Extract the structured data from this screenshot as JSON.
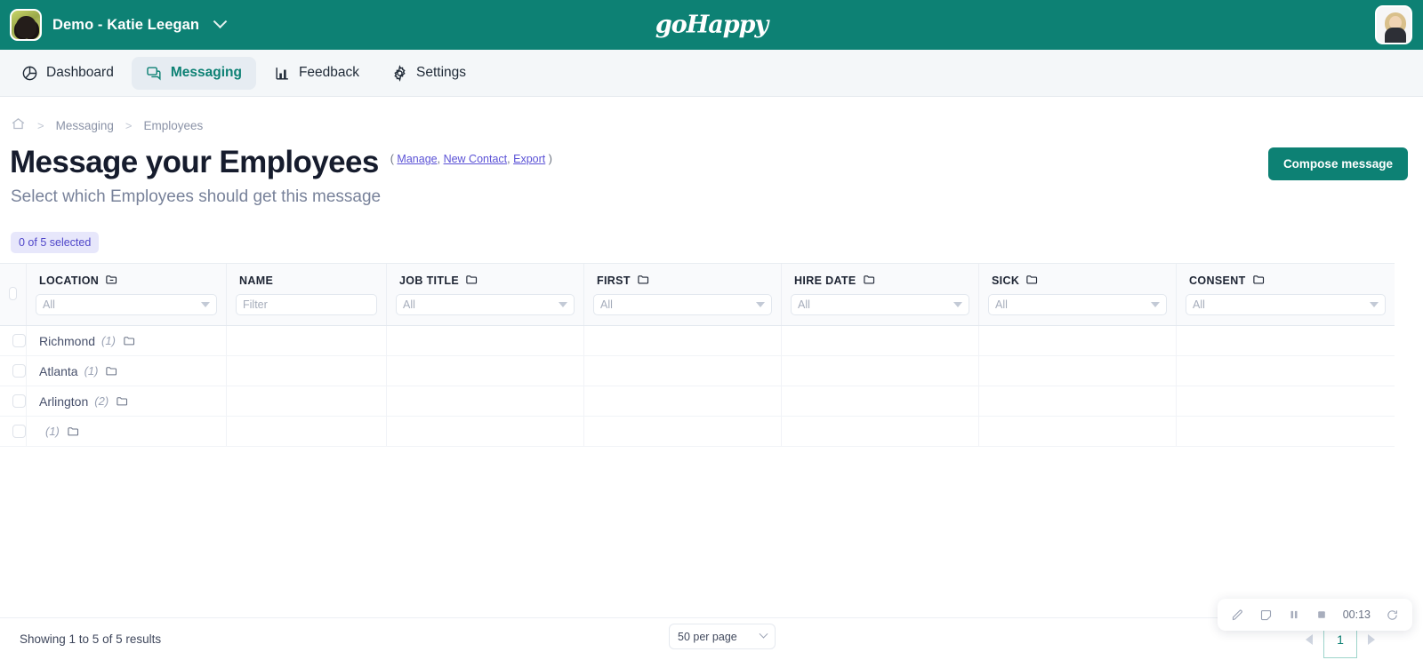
{
  "topbar": {
    "org_name": "Demo - Katie Leegan",
    "brand": "goHappy",
    "org_avatar_name": "org-avatar-dog",
    "user_avatar_name": "user-avatar",
    "accent_color": "#0d8174"
  },
  "nav": {
    "items": [
      {
        "label": "Dashboard",
        "icon": "pie-chart-icon",
        "active": false
      },
      {
        "label": "Messaging",
        "icon": "chat-bubbles-icon",
        "active": true
      },
      {
        "label": "Feedback",
        "icon": "bar-chart-icon",
        "active": false
      },
      {
        "label": "Settings",
        "icon": "gear-icon",
        "active": false
      }
    ]
  },
  "breadcrumb": {
    "home_icon": "home-icon",
    "separator": ">",
    "items": [
      "Messaging",
      "Employees"
    ]
  },
  "header": {
    "title": "Message your Employees",
    "subtitle": "Select which Employees should get this message",
    "actions_open": "(",
    "actions_close": ")",
    "actions": [
      "Manage",
      "New Contact",
      "Export"
    ],
    "comma": ",",
    "compose_label": "Compose message"
  },
  "selection": {
    "badge": "0 of 5 selected",
    "badge_bg": "#e7e7fb",
    "badge_fg": "#4f46c9"
  },
  "table": {
    "columns": [
      {
        "label": "LOCATION",
        "icon": "folder-minus-icon",
        "filter_type": "select",
        "filter_value": "All"
      },
      {
        "label": "NAME",
        "icon": "",
        "filter_type": "text",
        "filter_value": "Filter"
      },
      {
        "label": "JOB TITLE",
        "icon": "folder-icon",
        "filter_type": "select",
        "filter_value": "All"
      },
      {
        "label": "FIRST",
        "icon": "folder-icon",
        "filter_type": "select",
        "filter_value": "All"
      },
      {
        "label": "HIRE DATE",
        "icon": "folder-icon",
        "filter_type": "select",
        "filter_value": "All"
      },
      {
        "label": "SICK",
        "icon": "folder-icon",
        "filter_type": "select",
        "filter_value": "All"
      },
      {
        "label": "CONSENT",
        "icon": "folder-icon",
        "filter_type": "select",
        "filter_value": "All"
      }
    ],
    "rows": [
      {
        "location": "Richmond",
        "count": "(1)",
        "folder_icon": "folder-icon",
        "checked": false
      },
      {
        "location": "Atlanta",
        "count": "(1)",
        "folder_icon": "folder-icon",
        "checked": false
      },
      {
        "location": "Arlington",
        "count": "(2)",
        "folder_icon": "folder-icon",
        "checked": false
      },
      {
        "location": "",
        "count": "(1)",
        "folder_icon": "folder-icon",
        "checked": false
      }
    ]
  },
  "footer": {
    "showing": "Showing 1 to 5 of 5 results",
    "per_page": "50 per page",
    "page_current": "1",
    "prev_icon": "chevron-left-icon",
    "next_icon": "chevron-right-icon"
  },
  "recorder": {
    "timer": "00:13",
    "icons": [
      "pen-icon",
      "note-icon",
      "pause-icon",
      "stop-icon",
      "restart-icon"
    ]
  }
}
